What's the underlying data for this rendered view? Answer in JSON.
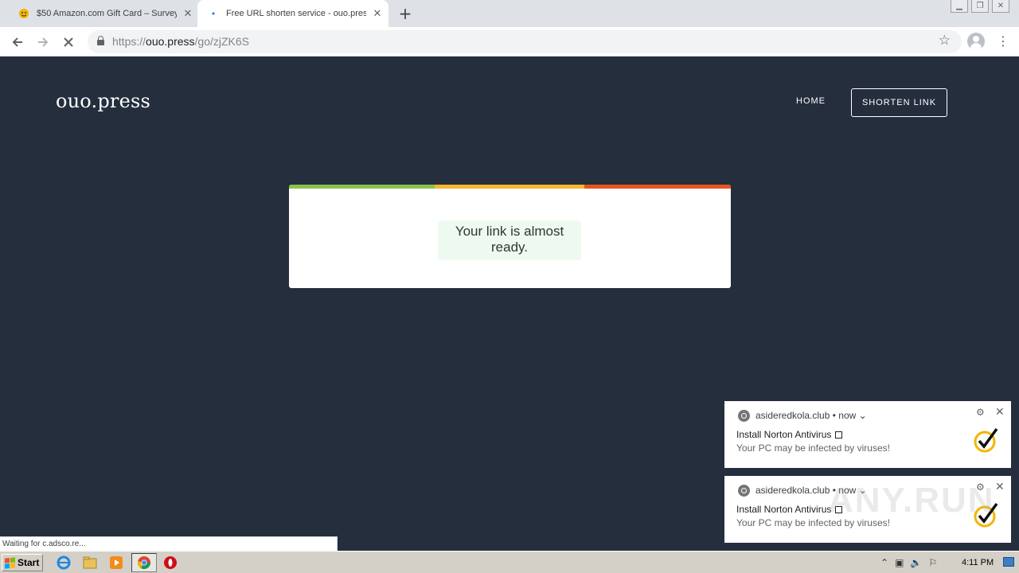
{
  "browser": {
    "tabs": [
      {
        "title": "$50 Amazon.com Gift Card – Survey",
        "active": false
      },
      {
        "title": "Free URL shorten service - ouo.press",
        "active": true
      }
    ],
    "url_scheme": "https://",
    "url_host": "ouo.press",
    "url_path": "/go/zjZK6S",
    "status_text": "Waiting for c.adsco.re..."
  },
  "site": {
    "logo": "ouo.press",
    "nav": {
      "home": "HOME",
      "shorten": "SHORTEN LINK"
    },
    "message": "Your link is almost ready.",
    "stripe_colors": [
      "#8bc34a",
      "#f5b82e",
      "#e8561e"
    ],
    "background": "#252e3d"
  },
  "notifications": [
    {
      "source": "asideredkola.club",
      "time": "now",
      "title": "Install Norton Antivirus",
      "body": "Your PC may be infected by viruses!"
    },
    {
      "source": "asideredkola.club",
      "time": "now",
      "title": "Install Norton Antivirus",
      "body": "Your PC may be infected by viruses!"
    }
  ],
  "taskbar": {
    "start_label": "Start",
    "clock": "4:11 PM"
  },
  "watermark": "ANY.RUN"
}
